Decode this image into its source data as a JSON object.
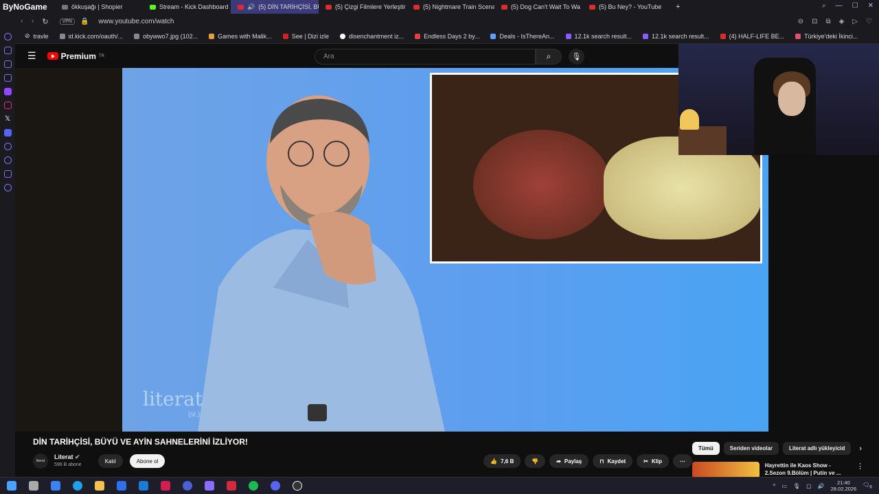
{
  "browser": {
    "brand": "ByNoGame",
    "tabs": [
      {
        "label": "ökkuşağı | Shopier",
        "icon": "plain"
      },
      {
        "label": "Stream - Kick Dashboard",
        "icon": "kick"
      },
      {
        "label": "(5) DİN TARİHÇİSİ, BÜ",
        "icon": "youtube",
        "active": true
      },
      {
        "label": "(5) Çizgi Filmlere Yerleştir",
        "icon": "youtube"
      },
      {
        "label": "(5) Nightmare Train Scena",
        "icon": "youtube"
      },
      {
        "label": "(5) Dog Can't Wait To Wa",
        "icon": "youtube"
      },
      {
        "label": "(5) Bu Ney? - YouTube",
        "icon": "youtube"
      }
    ],
    "new_tab": "+",
    "vpn": "VPN",
    "url": "www.youtube.com/watch",
    "bookmarks": [
      "travle",
      "id.kick.com/oauth/...",
      "obywwo7.jpg (102...",
      "Games with Malik...",
      "See | Dizi izle",
      "disenchantment iz...",
      "Endless Days 2 by...",
      "Deals - IsThereAn...",
      "12.1k search result...",
      "12.1k search result...",
      "(4) HALF-LIFE BE...",
      "Türkiye'deki İkinci..."
    ]
  },
  "youtube": {
    "logo_text": "Premium",
    "logo_sup": "TR",
    "search_placeholder": "Ara",
    "video": {
      "watermark": "literat",
      "watermark_sub": "(st.)",
      "title": "DİN TARİHÇİSİ, BÜYÜ VE AYİN SAHNELERİNİ İZLİYOR!"
    },
    "channel": {
      "avatar_text": "literat",
      "name": "Literat",
      "subs": "596 B abone",
      "join": "Katıl",
      "subscribe": "Abone ol"
    },
    "actions": {
      "likes": "7,6 B",
      "share": "Paylaş",
      "save": "Kaydet",
      "clip": "Klip"
    },
    "chips": [
      "Tümü",
      "Seriden videolar",
      "Literat adlı yükleyicid"
    ],
    "recommendation": {
      "title": "Hayrettin ile Kaos Show - 2.Sezon 9.Bölüm | Putin ve ..."
    }
  },
  "taskbar": {
    "time": "21:40",
    "date": "28.02.2026",
    "notif_count": "6"
  }
}
